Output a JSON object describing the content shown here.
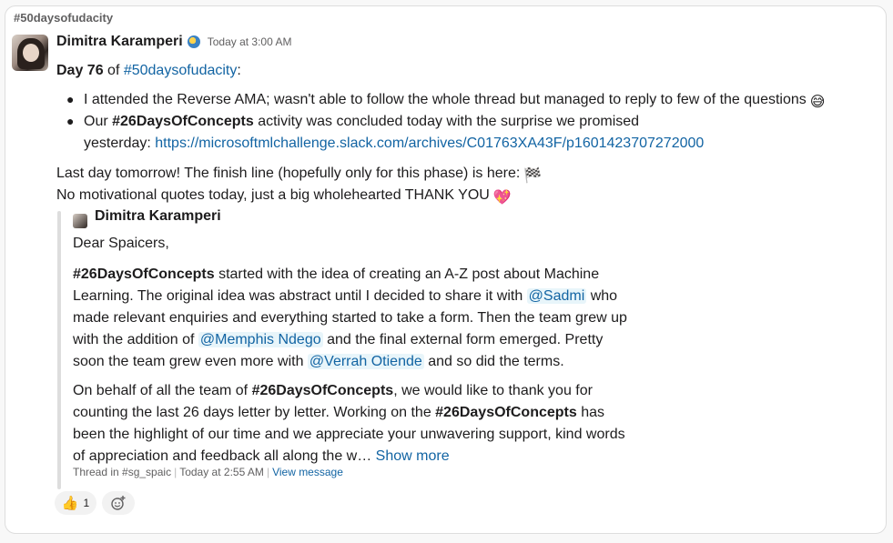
{
  "channel": "#50daysofudacity",
  "message": {
    "author": "Dimitra Karamperi",
    "timestamp": "Today at 3:00 AM",
    "day_bold": "Day 76",
    "of_text": " of ",
    "hashtag": "#50daysofudacity",
    "colon": ":",
    "bullet1": "I attended the Reverse AMA; wasn't able to follow the whole thread but managed to reply to few of the questions",
    "bullet2_pre": "Our ",
    "bullet2_bold": "#26DaysOfConcepts",
    "bullet2_post": " activity was concluded today with the surprise we promised",
    "bullet2_line2": "yesterday: ",
    "bullet2_link": "https://microsoftmlchallenge.slack.com/archives/C01763XA43F/p1601423707272000",
    "line_tomorrow": "Last day tomorrow! The finish line (hopefully only for this phase) is here:",
    "line_thanks": "No motivational quotes today, just a big wholehearted THANK YOU",
    "emoji_bullet1": "😅",
    "emoji_flag": "🏁",
    "emoji_heart": "💖"
  },
  "quote": {
    "author": "Dimitra Karamperi",
    "greeting": "Dear Spaicers,",
    "p1_l1_bold": "#26DaysOfConcepts",
    "p1_l1_rest": " started with the idea of creating an A-Z post about Machine",
    "p1_l2_pre": "Learning. The original idea was abstract until I decided to share it with ",
    "mention1": "@Sadmi",
    "p1_l2_post": " who",
    "p1_l3": "made relevant enquiries and everything started to take a form. Then the team grew up",
    "p1_l4_pre": "with the addition of ",
    "mention2": "@Memphis Ndego",
    "p1_l4_post": " and the final external form emerged. Pretty",
    "p1_l5_pre": "soon the team grew even more with ",
    "mention3": "@Verrah Otiende",
    "p1_l5_post": " and so did the terms.",
    "p2_l1_pre": "On behalf of all the team of ",
    "p2_l1_bold": "#26DaysOfConcepts",
    "p2_l1_post": ", we would like to thank you for",
    "p2_l2_pre": "counting the last 26 days letter by letter. Working on the ",
    "p2_l2_bold": "#26DaysOfConcepts",
    "p2_l2_post": " has",
    "p2_l3": "been the highlight of our time and we appreciate your unwavering support, kind words",
    "p2_l4": "of appreciation and feedback all along the w…",
    "show_more": "Show more",
    "footer_thread": "Thread in #sg_spaic",
    "footer_time": "Today at 2:55 AM",
    "footer_view": "View message"
  },
  "reactions": {
    "thumbs_icon": "👍",
    "thumbs_count": "1"
  },
  "colors": {
    "link": "#1264a3",
    "mention_bg": "#e8f5fa"
  }
}
